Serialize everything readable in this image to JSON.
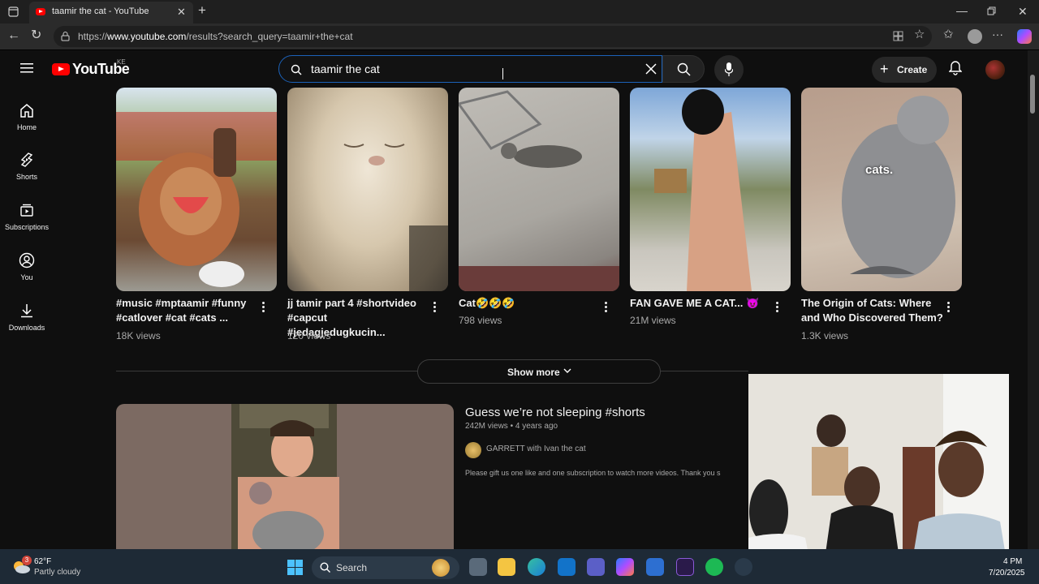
{
  "browser": {
    "tab_title": "taamir the cat - YouTube",
    "url_prefix": "https://",
    "url_host": "www.youtube.com",
    "url_path": "/results?search_query=taamir+the+cat"
  },
  "youtube": {
    "logo_text": "YouTube",
    "country_code": "KE",
    "search_value": "taamir the cat",
    "create_label": "Create"
  },
  "sidebar": {
    "items": [
      {
        "label": "Home",
        "icon": "home-icon"
      },
      {
        "label": "Shorts",
        "icon": "shorts-icon"
      },
      {
        "label": "Subscriptions",
        "icon": "subscriptions-icon"
      },
      {
        "label": "You",
        "icon": "you-icon"
      },
      {
        "label": "Downloads",
        "icon": "downloads-icon"
      }
    ]
  },
  "shorts": [
    {
      "title": "#music #mptaamir #funny #catlover #cat #cats ...",
      "views": "18K views"
    },
    {
      "title": "jj tamir part 4 #shortvideo #capcut #jedagjedugkucin...",
      "views": "120 views"
    },
    {
      "title": "Cat🤣🤣🤣",
      "views": "798 views"
    },
    {
      "title": "FAN GAVE ME A CAT... 😈",
      "views": "21M views"
    },
    {
      "title": "The Origin of Cats: Where and Who Discovered Them?",
      "views": "1.3K views",
      "thumb_caption": "cats."
    }
  ],
  "show_more": "Show more",
  "video": {
    "title": "Guess we’re not sleeping #shorts",
    "meta": "242M views • 4 years ago",
    "channel": "GARRETT with Ivan the cat",
    "description": "Please gift us one like and one subscription to watch more videos. Thank you s"
  },
  "taskbar": {
    "weather_badge": "3",
    "temperature": "62°F",
    "condition": "Partly cloudy",
    "search_label": "Search",
    "time": "4 PM",
    "date": "7/20/2025"
  }
}
